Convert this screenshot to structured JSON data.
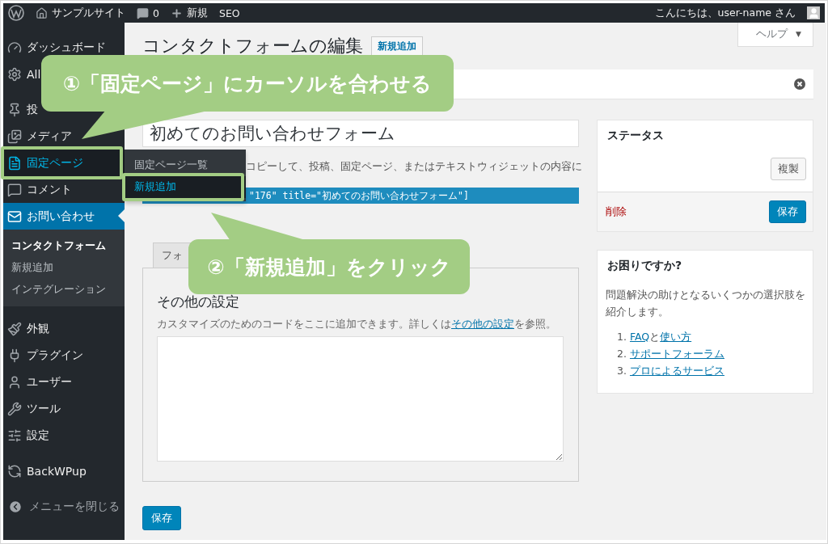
{
  "admin_bar": {
    "site_name": "サンプルサイト",
    "comments": "0",
    "new": "新規",
    "seo": "SEO",
    "greeting": "こんにちは、user-name さん"
  },
  "sidebar": {
    "groups": [
      [
        {
          "label": "ダッシュボード",
          "selected": false,
          "hovered": false
        },
        {
          "label": "All",
          "selected": false,
          "hovered": false
        }
      ],
      [
        {
          "label": "投",
          "selected": false,
          "hovered": false
        },
        {
          "label": "メディア",
          "selected": false,
          "hovered": false
        },
        {
          "label": "固定ページ",
          "selected": false,
          "hovered": true,
          "flyout": [
            {
              "label": "固定ページ一覧",
              "selected": false
            },
            {
              "label": "新規追加",
              "selected": true
            }
          ]
        },
        {
          "label": "コメント",
          "selected": false,
          "hovered": false
        },
        {
          "label": "お問い合わせ",
          "selected": true,
          "hovered": false,
          "children": [
            {
              "label": "コンタクトフォーム",
              "selected": true
            },
            {
              "label": "新規追加",
              "selected": false
            },
            {
              "label": "インテグレーション",
              "selected": false
            }
          ]
        }
      ],
      [
        {
          "label": "外観",
          "selected": false,
          "hovered": false
        },
        {
          "label": "プラグイン",
          "selected": false,
          "hovered": false
        },
        {
          "label": "ユーザー",
          "selected": false,
          "hovered": false
        },
        {
          "label": "ツール",
          "selected": false,
          "hovered": false
        },
        {
          "label": "設定",
          "selected": false,
          "hovered": false
        }
      ],
      [
        {
          "label": "BackWPup",
          "selected": false,
          "hovered": false
        }
      ]
    ],
    "collapse_label": "メニューを閉じる"
  },
  "help_tab": {
    "label": "ヘルプ",
    "arrow": "▼"
  },
  "page": {
    "title": "コンタクトフォームの編集",
    "add_new": "新規追加"
  },
  "form": {
    "title_value": "初めてのお問い合わせフォーム",
    "shortcode_note": "コピーして、投稿、固定ページ、またはテキストウィジェットの内容に",
    "shortcode": "\"176\" title=\"初めてのお問い合わせフォーム\"]",
    "tabs": [
      {
        "label": "フォ",
        "selected": false
      }
    ],
    "panel": {
      "heading": "その他の設定",
      "description": {
        "before": "カスタマイズのためのコードをここに追加できます。詳しくは",
        "link": "その他の設定",
        "after": "を参照。"
      }
    },
    "save": "保存"
  },
  "status_box": {
    "title": "ステータス",
    "duplicate": "複製",
    "delete": "削除",
    "save": "保存"
  },
  "help_box": {
    "title": "お困りですか?",
    "text": "問題解決の助けとなるいくつかの選択肢を紹介します。",
    "items": [
      {
        "number": "1.",
        "parts": [
          {
            "text": "FAQ",
            "link": true
          },
          {
            "text": "と",
            "link": false
          },
          {
            "text": "使い方",
            "link": true
          }
        ]
      },
      {
        "number": "2.",
        "parts": [
          {
            "text": "サポートフォーラム",
            "link": true
          }
        ]
      },
      {
        "number": "3.",
        "parts": [
          {
            "text": "プロによるサービス",
            "link": true
          }
        ]
      }
    ]
  },
  "callouts": [
    {
      "text": "①「固定ページ」にカーソルを合わせる",
      "kind": "tail-down"
    },
    {
      "text": "②「新規追加」をクリック",
      "kind": "tail-up"
    }
  ]
}
